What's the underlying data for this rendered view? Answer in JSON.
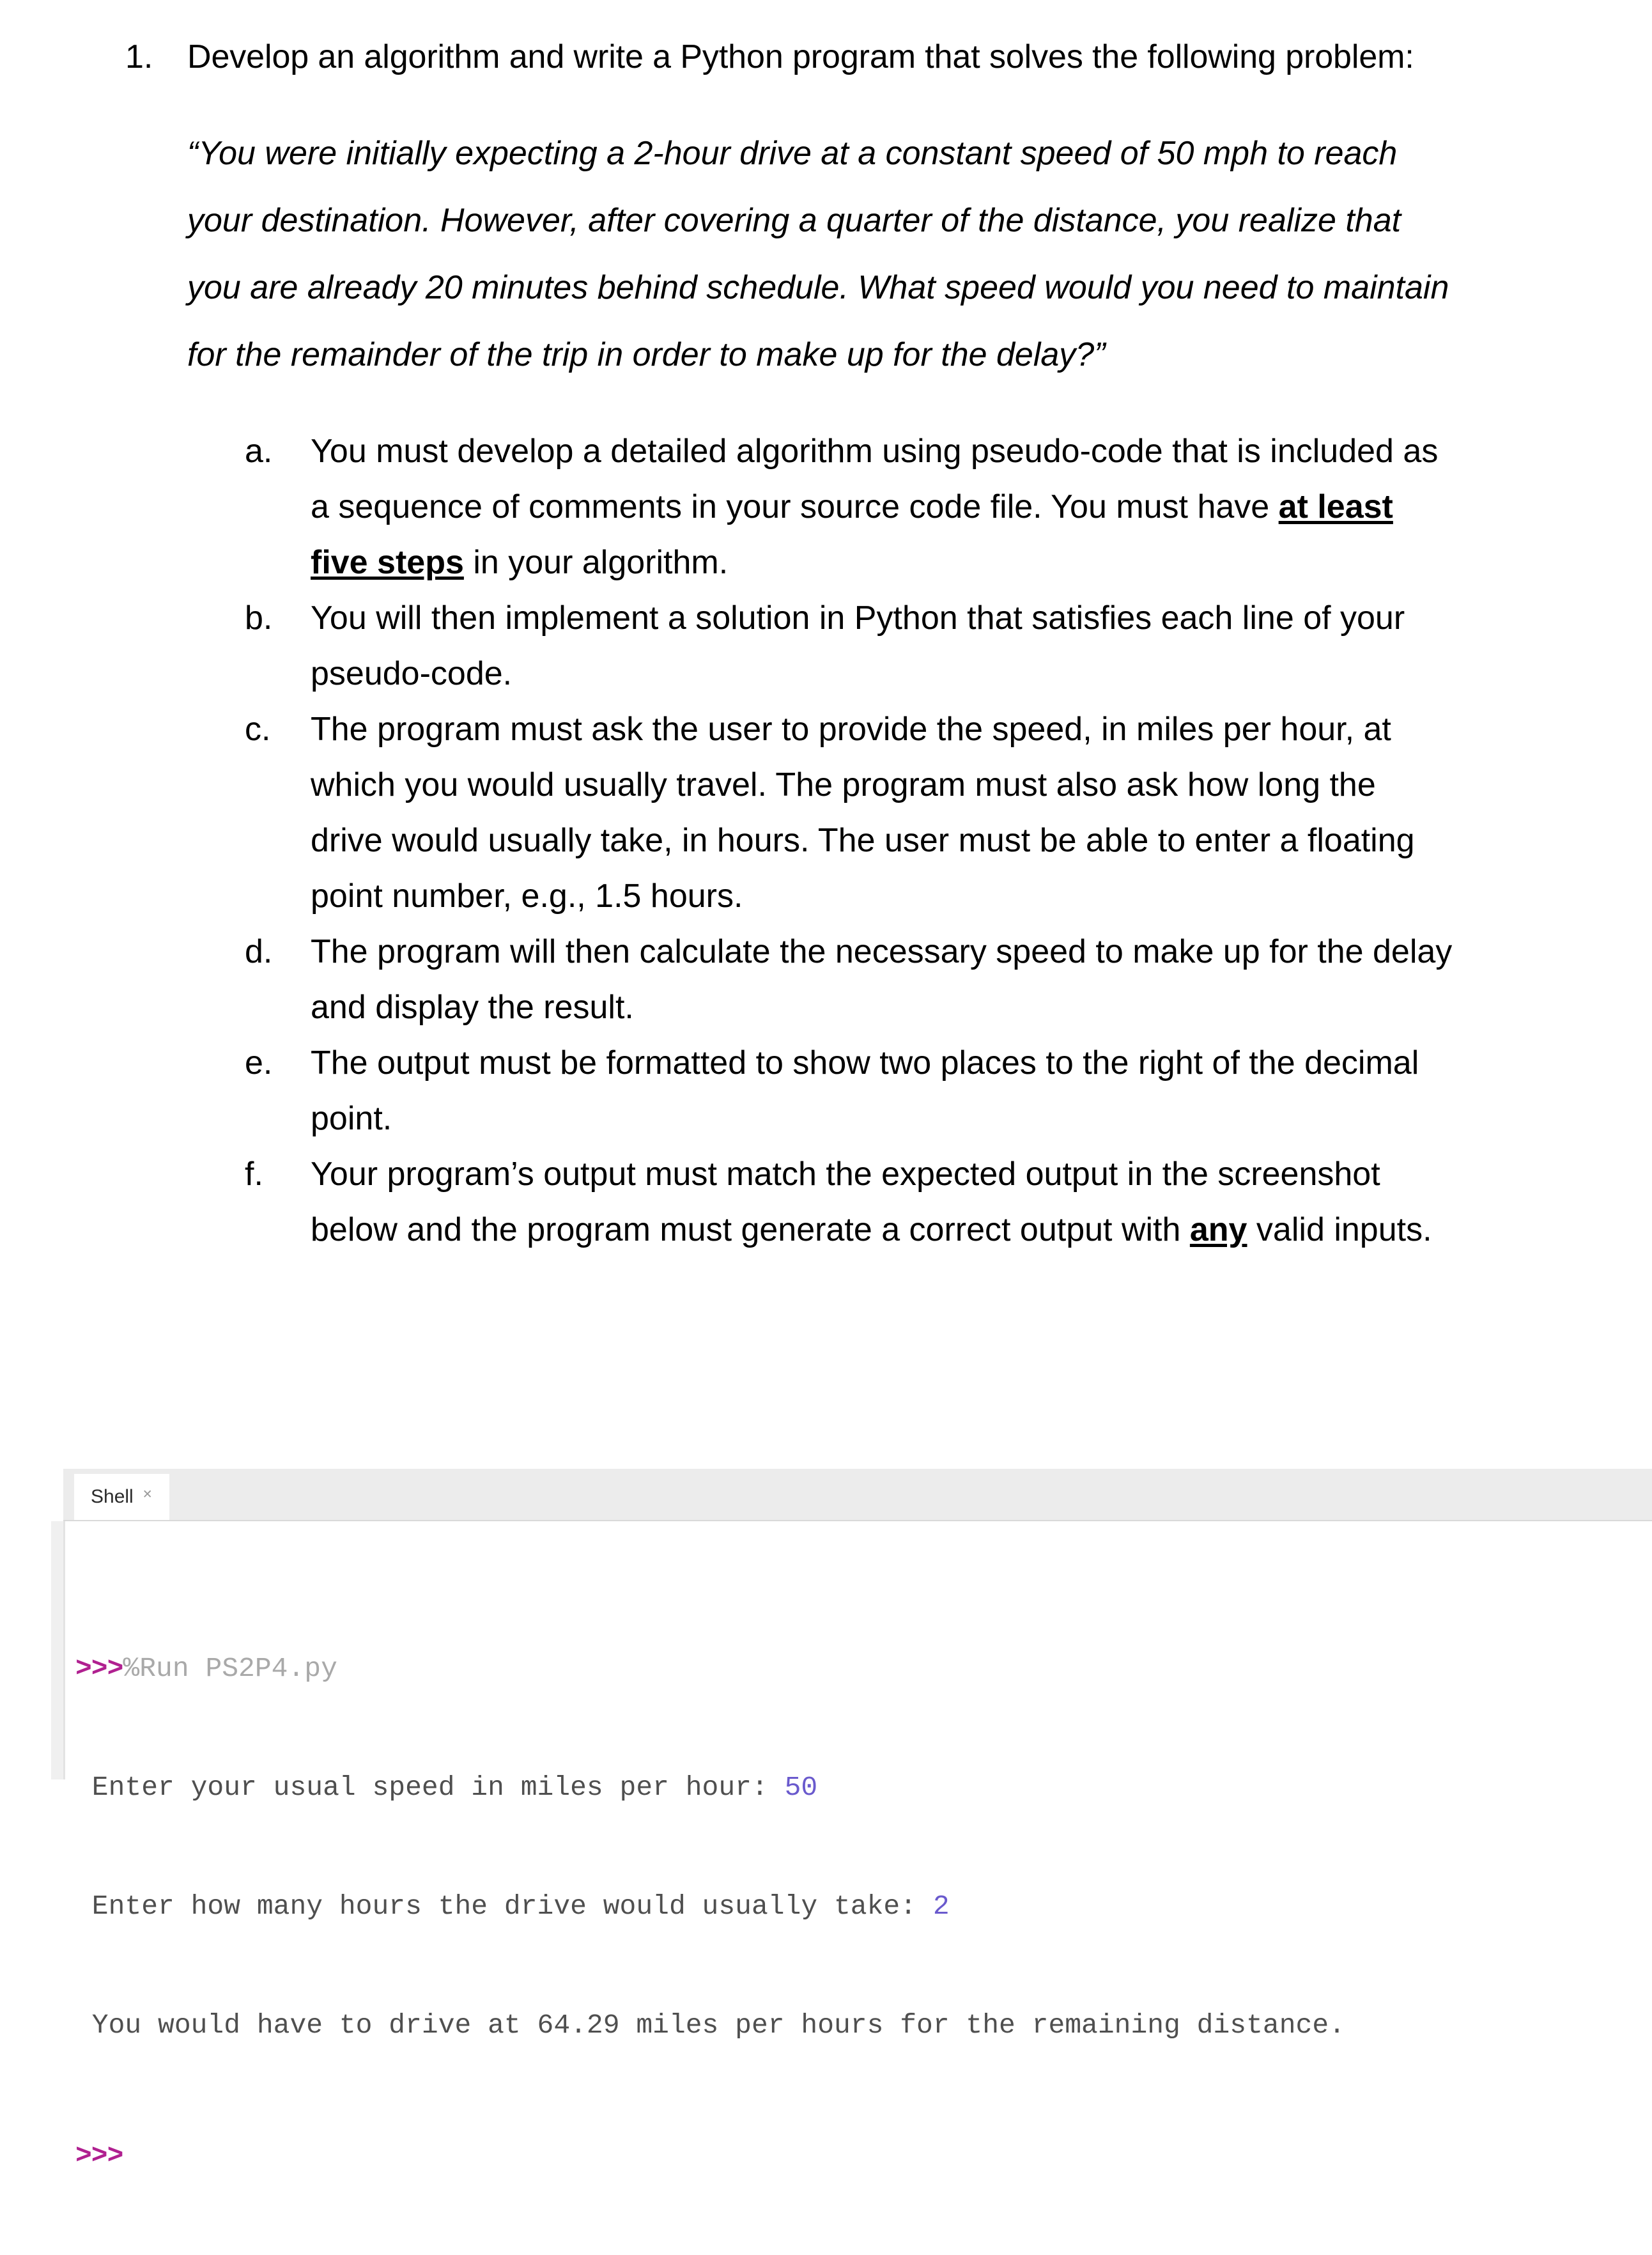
{
  "document": {
    "item_number": "1.",
    "intro": "Develop an algorithm and write a Python program that solves the following problem:",
    "quote": "“You were initially expecting a 2-hour drive at a constant speed of 50 mph to reach your destination. However, after covering a quarter of the distance, you realize that you are already 20 minutes behind schedule. What speed would you need to maintain for the remainder of the trip in order to make up for the delay?”",
    "sub_items": [
      {
        "marker": "a.",
        "text_before": "You must develop a detailed algorithm using pseudo-code that is included as a sequence of comments in your source code file. You must have ",
        "emphasis": "at least five steps",
        "text_after": " in your algorithm."
      },
      {
        "marker": "b.",
        "text_before": "You will then implement a solution in Python that satisfies each line of your pseudo-code.",
        "emphasis": "",
        "text_after": ""
      },
      {
        "marker": "c.",
        "text_before": "The program must ask the user to provide the speed, in miles per hour, at which you would usually travel. The program must also ask how long the drive would usually take, in hours. The user must be able to enter a floating point number, e.g., 1.5 hours.",
        "emphasis": "",
        "text_after": ""
      },
      {
        "marker": "d.",
        "text_before": "The program will then calculate the necessary speed to make up for the delay and display the result.",
        "emphasis": "",
        "text_after": ""
      },
      {
        "marker": "e.",
        "text_before": "The output must be formatted to show two places to the right of the decimal point.",
        "emphasis": "",
        "text_after": ""
      },
      {
        "marker": "f.",
        "text_before": "Your program’s output must match the expected output in the screenshot below and the program must generate a correct output with ",
        "emphasis": "any",
        "text_after": " valid inputs."
      }
    ]
  },
  "shell": {
    "tab_label": "Shell",
    "tab_close_icon": "close-icon",
    "prompt_symbol": ">>>",
    "run_command": "%Run PS2P4.py",
    "line_prompt_speed": " Enter your usual speed in miles per hour: ",
    "value_speed": "50",
    "line_prompt_hours": " Enter how many hours the drive would usually take: ",
    "value_hours": "2",
    "line_result": " You would have to drive at 64.29 miles per hours for the remaining distance.",
    "final_prompt": ">>>",
    "colors": {
      "prompt": "#b02090",
      "command": "#a9a9a9",
      "output": "#4f4f4f",
      "value": "#6a5acd",
      "tabbar_bg": "#ececec"
    }
  }
}
